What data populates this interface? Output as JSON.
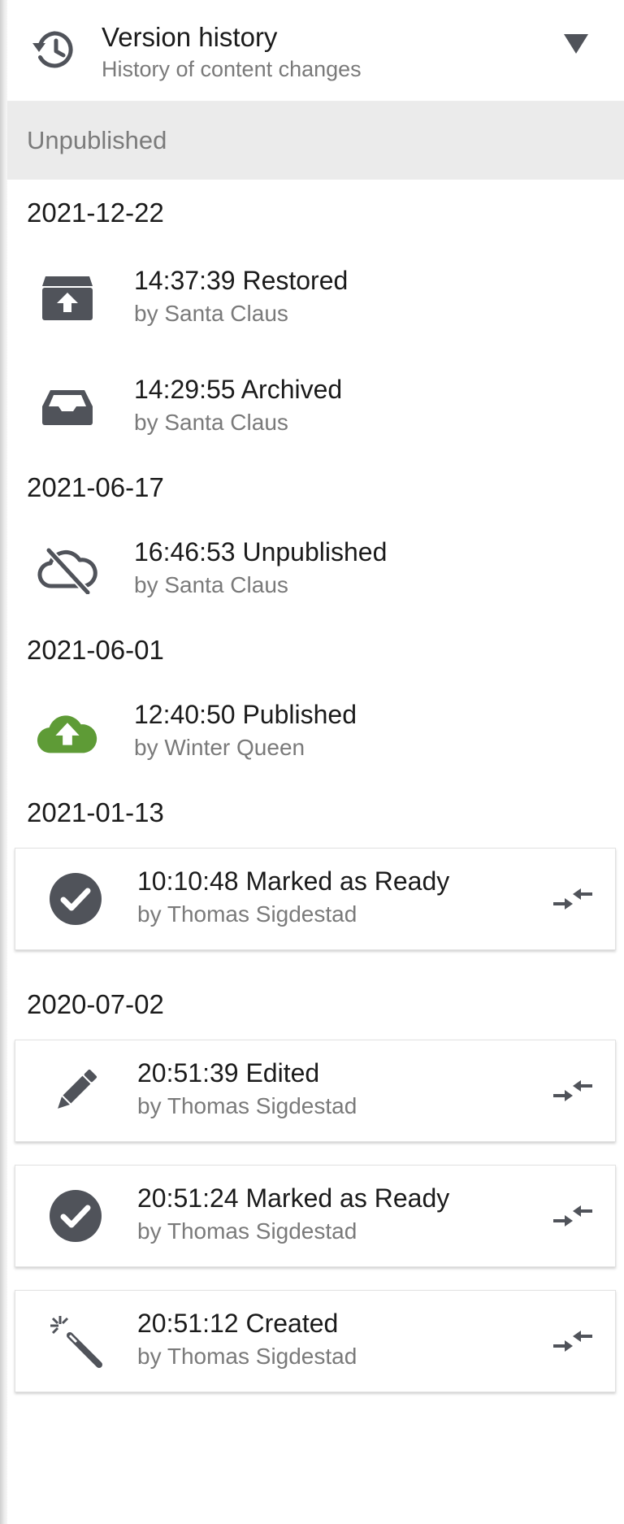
{
  "header": {
    "title": "Version history",
    "subtitle": "History of content changes",
    "icon": "history-icon",
    "toggle_icon": "caret-down-icon"
  },
  "section": {
    "label": "Unpublished"
  },
  "groups": [
    {
      "date": "2021-12-22",
      "entries": [
        {
          "time_action": "14:37:39 Restored",
          "by": "by Santa Claus",
          "icon": "restore-icon",
          "card": false
        },
        {
          "time_action": "14:29:55 Archived",
          "by": "by Santa Claus",
          "icon": "archive-icon",
          "card": false
        }
      ]
    },
    {
      "date": "2021-06-17",
      "entries": [
        {
          "time_action": "16:46:53 Unpublished",
          "by": "by Santa Claus",
          "icon": "cloud-off-icon",
          "card": false
        }
      ]
    },
    {
      "date": "2021-06-01",
      "entries": [
        {
          "time_action": "12:40:50 Published",
          "by": "by Winter Queen",
          "icon": "cloud-upload-icon",
          "card": false
        }
      ]
    },
    {
      "date": "2021-01-13",
      "entries": [
        {
          "time_action": "10:10:48 Marked as Ready",
          "by": "by Thomas Sigdestad",
          "icon": "check-circle-icon",
          "card": true
        }
      ]
    },
    {
      "date": "2020-07-02",
      "entries": [
        {
          "time_action": "20:51:39 Edited",
          "by": "by Thomas Sigdestad",
          "icon": "pencil-icon",
          "card": true
        },
        {
          "time_action": "20:51:24 Marked as Ready",
          "by": "by Thomas Sigdestad",
          "icon": "check-circle-icon",
          "card": true
        },
        {
          "time_action": "20:51:12 Created",
          "by": "by Thomas Sigdestad",
          "icon": "magic-wand-icon",
          "card": true
        }
      ]
    }
  ],
  "colors": {
    "icon_gray": "#50535a",
    "published_green": "#5e9b36",
    "section_bg": "#ebebeb",
    "muted_text": "#7a7a7a"
  }
}
